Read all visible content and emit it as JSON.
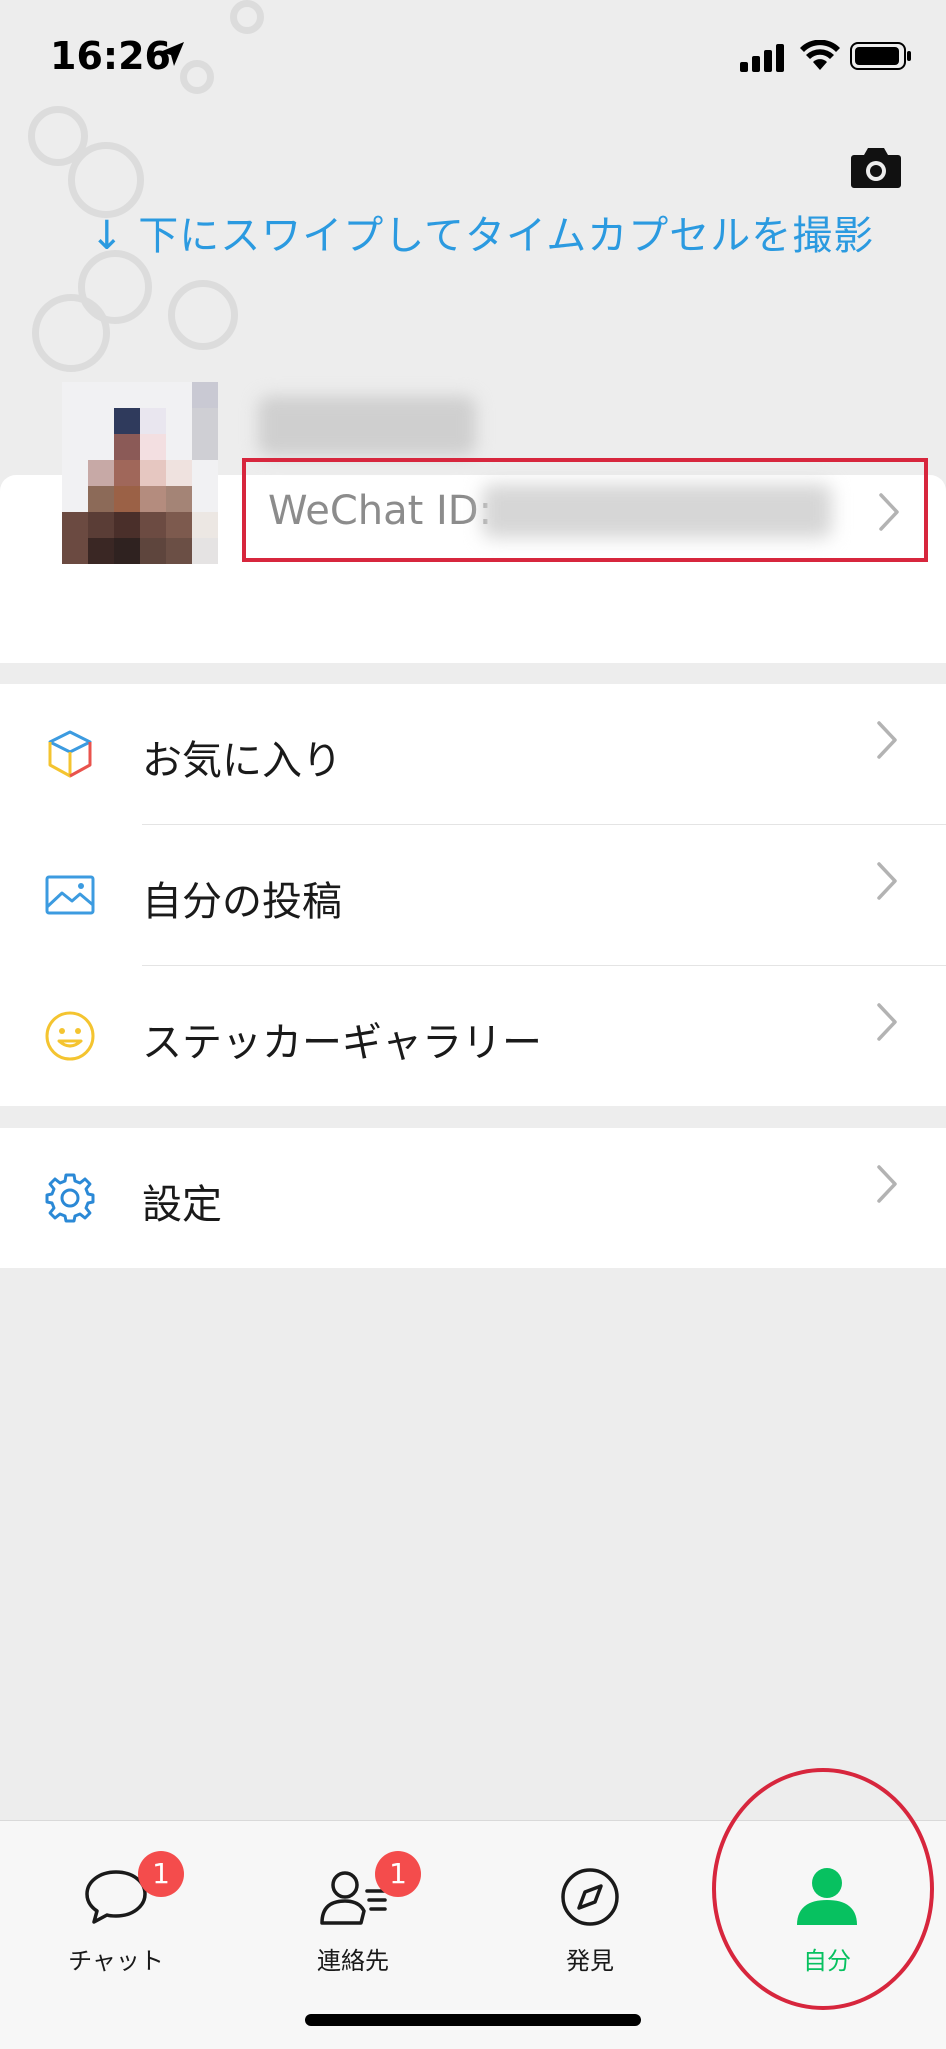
{
  "status_bar": {
    "time": "16:26"
  },
  "header": {
    "swipe_hint": "↓ 下にスワイプしてタイムカプセルを撮影"
  },
  "profile": {
    "wechat_id_label": "WeChat ID:"
  },
  "menu": {
    "items": [
      {
        "label": "お気に入り"
      },
      {
        "label": "自分の投稿"
      },
      {
        "label": "ステッカーギャラリー"
      },
      {
        "label": "設定"
      }
    ]
  },
  "tabbar": {
    "tabs": [
      {
        "label": "チャット",
        "badge": "1"
      },
      {
        "label": "連絡先",
        "badge": "1"
      },
      {
        "label": "発見"
      },
      {
        "label": "自分"
      }
    ]
  },
  "colors": {
    "accent_green": "#07c160",
    "link_blue": "#2b9ae0",
    "badge_red": "#f44c4c",
    "highlight_red": "#d7263d"
  }
}
